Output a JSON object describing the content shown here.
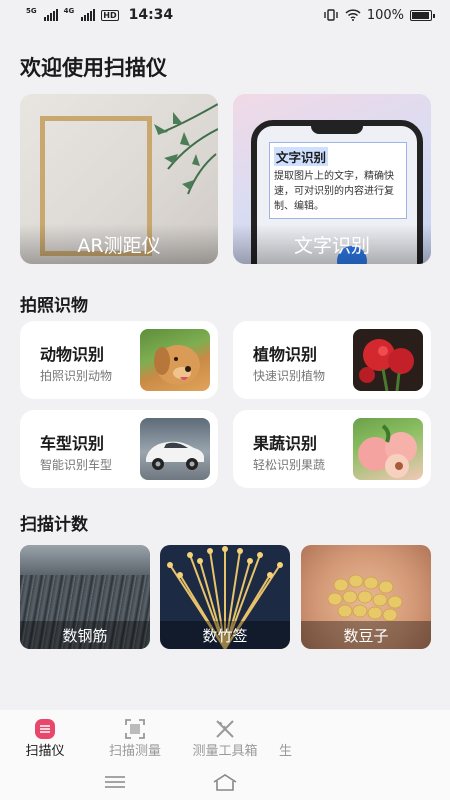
{
  "status_bar": {
    "sim1": "5G",
    "sim2": "4G",
    "hd": "HD",
    "time": "14:34",
    "battery": "100%",
    "battery_level": 1.0
  },
  "page_title": "欢迎使用扫描仪",
  "features": [
    {
      "label": "AR测距仪",
      "icon": "ar-measure-illustration"
    },
    {
      "label": "文字识别",
      "icon": "text-recognition-illustration"
    }
  ],
  "ocr_sample": {
    "title": "文字识别",
    "body": "提取图片上的文字，精确快速，可对识别的内容进行复制、编辑。"
  },
  "section_photo": "拍照识物",
  "recognition": [
    {
      "name": "动物识别",
      "desc": "拍照识别动物",
      "thumb": "dog-photo"
    },
    {
      "name": "植物识别",
      "desc": "快速识别植物",
      "thumb": "flower-photo"
    },
    {
      "name": "车型识别",
      "desc": "智能识别车型",
      "thumb": "car-photo"
    },
    {
      "name": "果蔬识别",
      "desc": "轻松识别果蔬",
      "thumb": "peach-photo"
    }
  ],
  "section_count": "扫描计数",
  "counting": [
    {
      "label": "数钢筋",
      "thumb": "rebar-photo"
    },
    {
      "label": "数竹签",
      "thumb": "bamboo-sticks-photo"
    },
    {
      "label": "数豆子",
      "thumb": "beans-photo"
    }
  ],
  "nav": [
    {
      "label": "扫描仪",
      "icon": "scanner-icon",
      "active": true
    },
    {
      "label": "扫描测量",
      "icon": "scan-frame-icon",
      "active": false
    },
    {
      "label": "测量工具箱",
      "icon": "ruler-tools-icon",
      "active": false
    },
    {
      "label": "生",
      "icon": "",
      "active": false
    }
  ],
  "colors": {
    "background": "#f1f1f4",
    "accent": "#e8466a",
    "ocr_highlight": "#cfe0ff",
    "ocr_dot": "#2f7cf0"
  }
}
